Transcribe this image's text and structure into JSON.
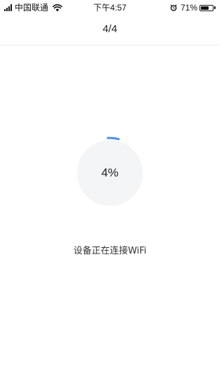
{
  "status_bar": {
    "carrier": "中国联通",
    "time": "下午4:57",
    "battery_percent": "71%",
    "battery_level": 0.71,
    "icons": [
      "signal-icon",
      "wifi-icon",
      "alarm-icon",
      "battery-icon"
    ]
  },
  "nav": {
    "title": "4/4"
  },
  "progress": {
    "label": "4%",
    "value": 0.04,
    "ring_color": "#4A90E2",
    "circle_color": "#F4F5F7"
  },
  "message": "设备正在连接WiFi"
}
